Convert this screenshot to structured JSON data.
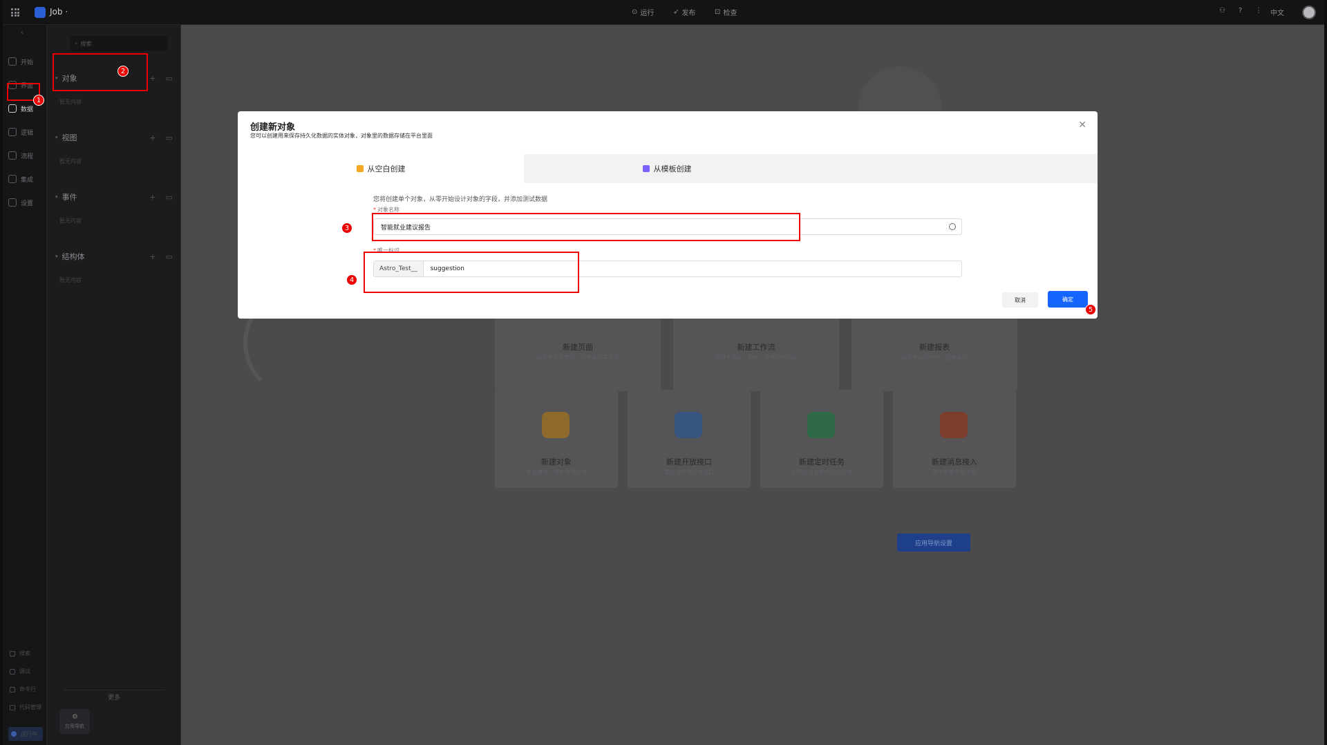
{
  "topbar": {
    "app_name": "Job ·",
    "run_label": "运行",
    "publish_label": "发布",
    "check_label": "检查",
    "lang_label": "中文"
  },
  "rail": {
    "items": [
      {
        "label": "开始"
      },
      {
        "label": "界面"
      },
      {
        "label": "数据"
      },
      {
        "label": "逻辑"
      },
      {
        "label": "流程"
      },
      {
        "label": "集成"
      },
      {
        "label": "设置"
      }
    ],
    "bottom": [
      {
        "label": "搜索"
      },
      {
        "label": "调试"
      },
      {
        "label": "命令行"
      },
      {
        "label": "代码管理"
      },
      {
        "label": "运行中"
      }
    ]
  },
  "panel": {
    "search_placeholder": "搜索",
    "sections": [
      {
        "title": "对象",
        "empty": "暂无内容"
      },
      {
        "title": "视图",
        "empty": "暂无内容"
      },
      {
        "title": "事件",
        "empty": "暂无内容"
      },
      {
        "title": "结构体",
        "empty": "暂无内容"
      }
    ],
    "more_label": "更多",
    "nav_settings_label": "应用导航"
  },
  "main": {
    "big_cards": [
      {
        "title": "新建页面",
        "desc": "适用于业务管理、信息展示等页面"
      },
      {
        "title": "新建工作流",
        "desc": "适用于审批、协作、业务流转场景"
      },
      {
        "title": "新建报表",
        "desc": "适用于统计分析、图表展示"
      }
    ],
    "small_cards": [
      {
        "title": "新建对象",
        "desc": "数据建模，用于存储业务",
        "icon": "object-icon",
        "color": "#b9872c"
      },
      {
        "title": "新建开放接口",
        "desc": "第三方开放业务接口",
        "icon": "api-icon",
        "color": "#3c6fb5"
      },
      {
        "title": "新建定时任务",
        "desc": "系统后台定期完成的任务",
        "icon": "schedule-icon",
        "color": "#2e8f55"
      },
      {
        "title": "新建消息接入",
        "desc": "用于采集外部消息",
        "icon": "message-icon",
        "color": "#b84a2e"
      }
    ],
    "nav_button_label": "应用导航设置"
  },
  "modal": {
    "title": "创建新对象",
    "subtitle": "您可以创建用来保存持久化数据的实体对象，对象里的数据存储在平台里面",
    "tabs": [
      {
        "label": "从空白创建",
        "color": "#f5a623"
      },
      {
        "label": "从模板创建",
        "color": "#7b61ff"
      }
    ],
    "hint": "您将创建单个对象，从零开始设计对象的字段，并添加测试数据",
    "name_label": "对象名称",
    "name_value": "智能就业建议报告",
    "id_label": "唯一标识",
    "id_prefix": "Astro_Test__",
    "id_value": "suggestion",
    "cancel_label": "取消",
    "ok_label": "确定"
  },
  "annotations": [
    "1",
    "2",
    "3",
    "4",
    "5"
  ]
}
